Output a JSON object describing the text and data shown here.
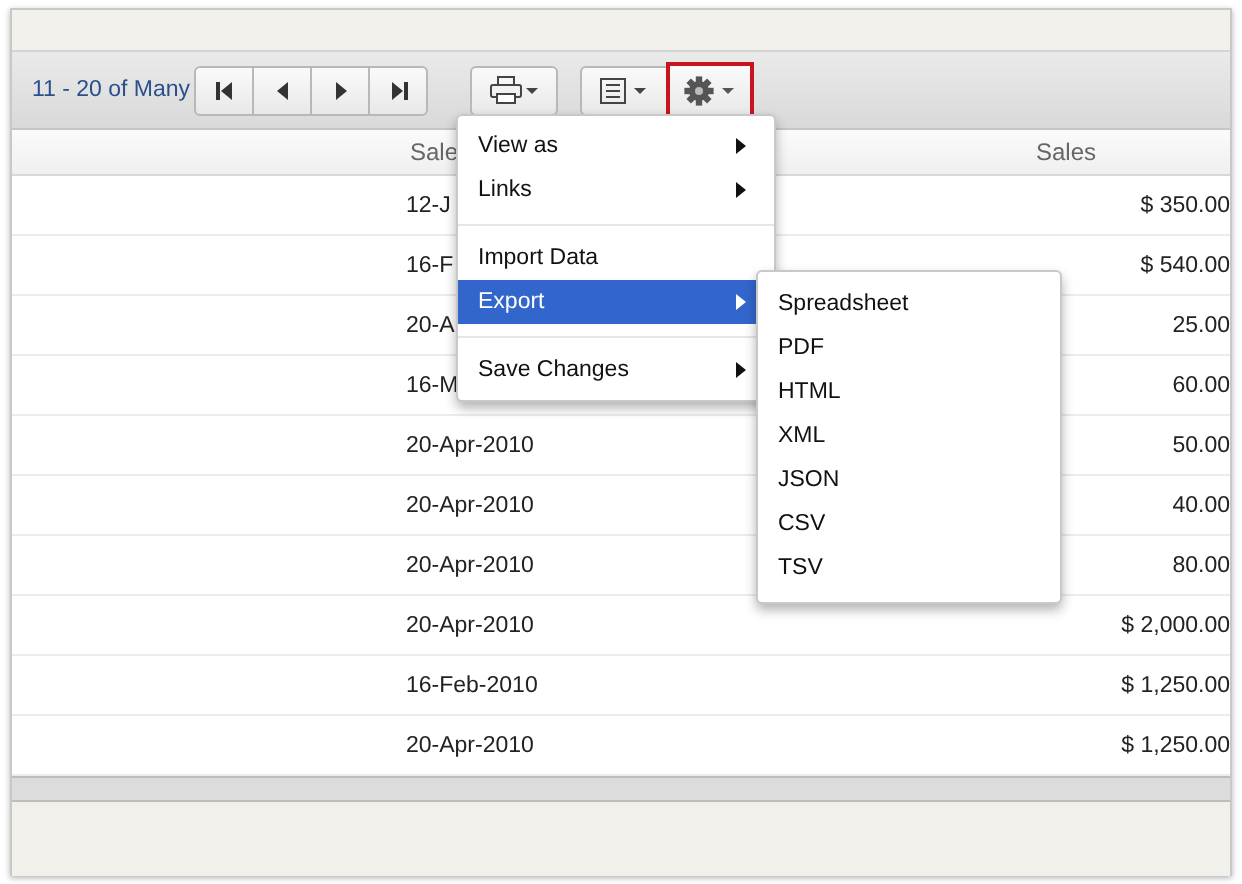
{
  "toolbar": {
    "page_label": "11 - 20 of Many",
    "gear_highlighted": true
  },
  "table": {
    "columns": [
      "Sale",
      "Sales"
    ],
    "rows": [
      {
        "date": "12-J",
        "sales": "$ 350.00"
      },
      {
        "date": "16-F",
        "sales": "$ 540.00"
      },
      {
        "date": "20-A",
        "sales": "25.00"
      },
      {
        "date": "16-M",
        "sales": "60.00"
      },
      {
        "date": "20-Apr-2010",
        "sales": "50.00"
      },
      {
        "date": "20-Apr-2010",
        "sales": "40.00"
      },
      {
        "date": "20-Apr-2010",
        "sales": "80.00"
      },
      {
        "date": "20-Apr-2010",
        "sales": "$ 2,000.00"
      },
      {
        "date": "16-Feb-2010",
        "sales": "$ 1,250.00"
      },
      {
        "date": "20-Apr-2010",
        "sales": "$ 1,250.00"
      }
    ]
  },
  "menu": {
    "groups": [
      [
        {
          "label": "View as",
          "has_submenu": true,
          "selected": false
        },
        {
          "label": "Links",
          "has_submenu": true,
          "selected": false
        }
      ],
      [
        {
          "label": "Import Data",
          "has_submenu": false,
          "selected": false
        },
        {
          "label": "Export",
          "has_submenu": true,
          "selected": true
        }
      ],
      [
        {
          "label": "Save Changes",
          "has_submenu": true,
          "selected": false
        }
      ]
    ]
  },
  "submenu": {
    "items": [
      "Spreadsheet",
      "PDF",
      "HTML",
      "XML",
      "JSON",
      "CSV",
      "TSV"
    ]
  }
}
